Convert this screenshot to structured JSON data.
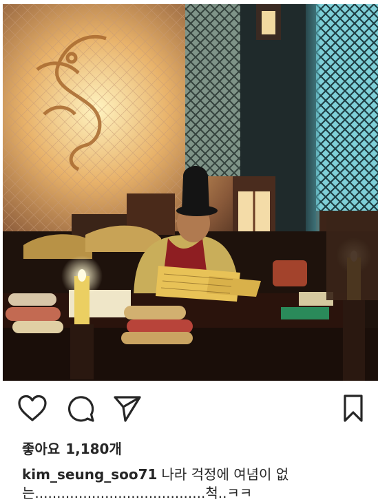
{
  "post": {
    "image_alt": "",
    "likes_label": "좋아요",
    "likes_count": "1,180개",
    "username": "kim_seung_soo71",
    "caption": "나라 걱정에 여념이 없는.......................................척..ㅋㅋ"
  },
  "actions": {
    "icons": [
      "heart-icon",
      "comment-icon",
      "share-icon",
      "bookmark-icon"
    ]
  },
  "colors": {
    "text": "#262626",
    "background": "#ffffff"
  }
}
